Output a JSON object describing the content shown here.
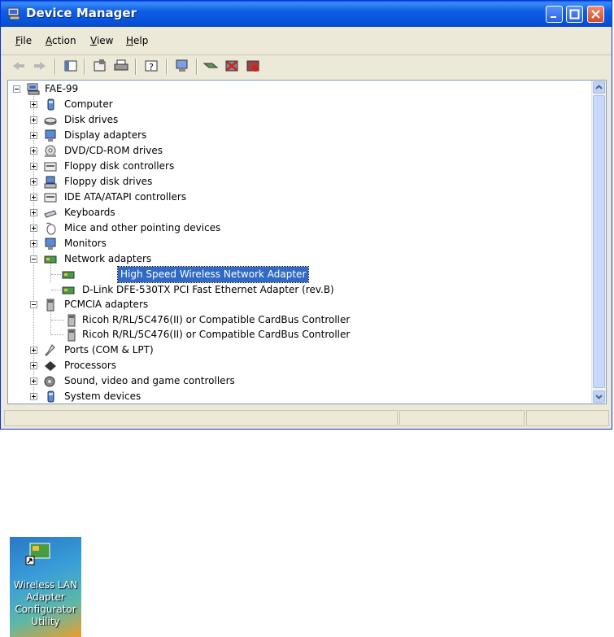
{
  "window": {
    "title": "Device Manager",
    "title_icon": "computer-icon"
  },
  "menu": {
    "file": {
      "ul": "F",
      "rest": "ile"
    },
    "action": {
      "ul": "A",
      "rest": "ction"
    },
    "view": {
      "ul": "V",
      "rest": "iew"
    },
    "help": {
      "ul": "H",
      "rest": "elp"
    }
  },
  "tree": {
    "root": "FAE-99",
    "items": [
      {
        "label": "Computer",
        "icon": "computer-icon"
      },
      {
        "label": "Disk drives",
        "icon": "disk-drive-icon"
      },
      {
        "label": "Display adapters",
        "icon": "display-icon"
      },
      {
        "label": "DVD/CD-ROM drives",
        "icon": "dvd-icon"
      },
      {
        "label": "Floppy disk controllers",
        "icon": "controller-icon"
      },
      {
        "label": "Floppy disk drives",
        "icon": "floppy-icon"
      },
      {
        "label": "IDE ATA/ATAPI controllers",
        "icon": "controller-icon"
      },
      {
        "label": "Keyboards",
        "icon": "keyboard-icon"
      },
      {
        "label": "Mice and other pointing devices",
        "icon": "mouse-icon"
      },
      {
        "label": "Monitors",
        "icon": "monitor-icon"
      },
      {
        "label": "Network adapters",
        "icon": "network-card-icon"
      },
      {
        "label": "High Speed Wireless Network Adapter",
        "icon": "network-card-icon"
      },
      {
        "label": "D-Link DFE-530TX PCI Fast Ethernet Adapter (rev.B)",
        "icon": "network-card-icon"
      },
      {
        "label": "PCMCIA adapters",
        "icon": "pcmcia-icon"
      },
      {
        "label": "Ricoh R/RL/5C476(II) or Compatible CardBus Controller",
        "icon": "pcmcia-icon"
      },
      {
        "label": "Ricoh R/RL/5C476(II) or Compatible CardBus Controller",
        "icon": "pcmcia-icon"
      },
      {
        "label": "Ports (COM & LPT)",
        "icon": "port-icon"
      },
      {
        "label": "Processors",
        "icon": "processor-icon"
      },
      {
        "label": "Sound, video and game controllers",
        "icon": "sound-icon"
      },
      {
        "label": "System devices",
        "icon": "system-icon"
      }
    ]
  },
  "desktop_shortcut": {
    "line1": "Wireless LAN",
    "line2": "Adapter",
    "line3": "Configurator",
    "line4": "Utility"
  },
  "colors": {
    "titlebar": "#0651d9",
    "selection": "#316ac5",
    "chrome": "#ece9d8"
  }
}
